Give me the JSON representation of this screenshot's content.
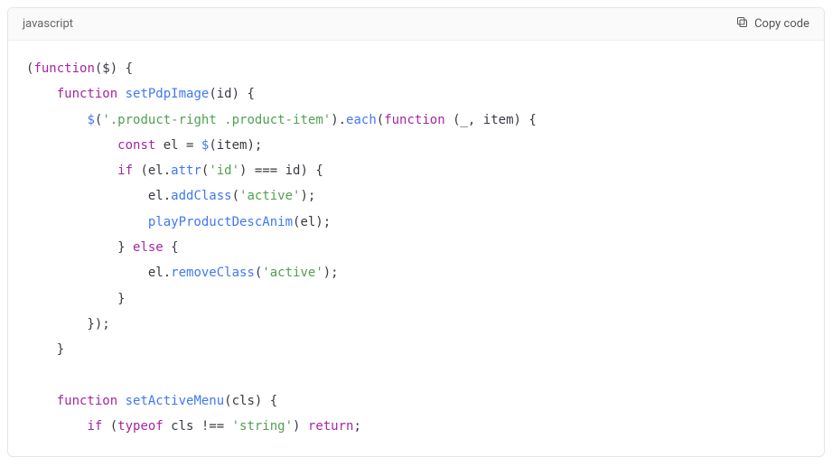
{
  "header": {
    "language_label": "javascript",
    "copy_label": "Copy code"
  },
  "code": {
    "tokens": [
      {
        "t": "(",
        "c": "punct"
      },
      {
        "t": "function",
        "c": "kw"
      },
      {
        "t": "($) {",
        "c": "punct"
      },
      {
        "nl": 1
      },
      {
        "t": "    ",
        "c": "punct"
      },
      {
        "t": "function",
        "c": "kw"
      },
      {
        "t": " ",
        "c": "punct"
      },
      {
        "t": "setPdpImage",
        "c": "fnname"
      },
      {
        "t": "(id) {",
        "c": "punct"
      },
      {
        "nl": 1
      },
      {
        "t": "        ",
        "c": "punct"
      },
      {
        "t": "$",
        "c": "fnname"
      },
      {
        "t": "(",
        "c": "punct"
      },
      {
        "t": "'.product-right .product-item'",
        "c": "str"
      },
      {
        "t": ").",
        "c": "punct"
      },
      {
        "t": "each",
        "c": "fnname"
      },
      {
        "t": "(",
        "c": "punct"
      },
      {
        "t": "function",
        "c": "kw"
      },
      {
        "t": " (_, item) {",
        "c": "punct"
      },
      {
        "nl": 1
      },
      {
        "t": "            ",
        "c": "punct"
      },
      {
        "t": "const",
        "c": "kw"
      },
      {
        "t": " el = ",
        "c": "punct"
      },
      {
        "t": "$",
        "c": "fnname"
      },
      {
        "t": "(item);",
        "c": "punct"
      },
      {
        "nl": 1
      },
      {
        "t": "            ",
        "c": "punct"
      },
      {
        "t": "if",
        "c": "kw"
      },
      {
        "t": " (el.",
        "c": "punct"
      },
      {
        "t": "attr",
        "c": "fnname"
      },
      {
        "t": "(",
        "c": "punct"
      },
      {
        "t": "'id'",
        "c": "str"
      },
      {
        "t": ") === id) {",
        "c": "punct"
      },
      {
        "nl": 1
      },
      {
        "t": "                el.",
        "c": "punct"
      },
      {
        "t": "addClass",
        "c": "fnname"
      },
      {
        "t": "(",
        "c": "punct"
      },
      {
        "t": "'active'",
        "c": "str"
      },
      {
        "t": ");",
        "c": "punct"
      },
      {
        "nl": 1
      },
      {
        "t": "                ",
        "c": "punct"
      },
      {
        "t": "playProductDescAnim",
        "c": "fnname"
      },
      {
        "t": "(el);",
        "c": "punct"
      },
      {
        "nl": 1
      },
      {
        "t": "            } ",
        "c": "punct"
      },
      {
        "t": "else",
        "c": "kw"
      },
      {
        "t": " {",
        "c": "punct"
      },
      {
        "nl": 1
      },
      {
        "t": "                el.",
        "c": "punct"
      },
      {
        "t": "removeClass",
        "c": "fnname"
      },
      {
        "t": "(",
        "c": "punct"
      },
      {
        "t": "'active'",
        "c": "str"
      },
      {
        "t": ");",
        "c": "punct"
      },
      {
        "nl": 1
      },
      {
        "t": "            }",
        "c": "punct"
      },
      {
        "nl": 1
      },
      {
        "t": "        });",
        "c": "punct"
      },
      {
        "nl": 1
      },
      {
        "t": "    }",
        "c": "punct"
      },
      {
        "nl": 1
      },
      {
        "nl": 1
      },
      {
        "t": "    ",
        "c": "punct"
      },
      {
        "t": "function",
        "c": "kw"
      },
      {
        "t": " ",
        "c": "punct"
      },
      {
        "t": "setActiveMenu",
        "c": "fnname"
      },
      {
        "t": "(cls) {",
        "c": "punct"
      },
      {
        "nl": 1
      },
      {
        "t": "        ",
        "c": "punct"
      },
      {
        "t": "if",
        "c": "kw"
      },
      {
        "t": " (",
        "c": "punct"
      },
      {
        "t": "typeof",
        "c": "kw"
      },
      {
        "t": " cls !== ",
        "c": "punct"
      },
      {
        "t": "'string'",
        "c": "str"
      },
      {
        "t": ") ",
        "c": "punct"
      },
      {
        "t": "return",
        "c": "kw"
      },
      {
        "t": ";",
        "c": "punct"
      }
    ]
  }
}
